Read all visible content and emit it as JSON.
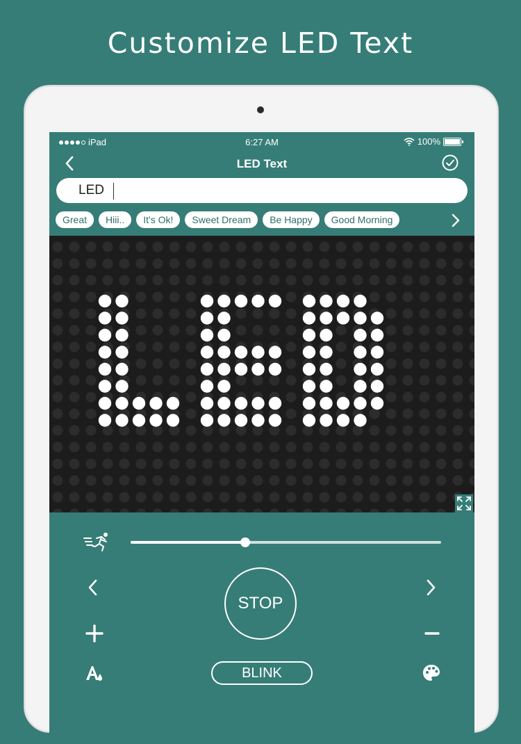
{
  "promo": {
    "title": "Customize LED Text"
  },
  "status_bar": {
    "carrier": "iPad",
    "time": "6:27 AM",
    "battery": "100%"
  },
  "nav": {
    "title": "LED Text"
  },
  "input": {
    "value": "LED"
  },
  "chips": [
    "Great",
    "Hiii..",
    "It's Ok!",
    "Sweet Dream",
    "Be Happy",
    "Good Morning"
  ],
  "display": {
    "text": "LED",
    "led_color": "#ffffff",
    "background_color": "#1c1c1c",
    "off_led_color": "#2c2c2c"
  },
  "controls": {
    "speed": 0.37,
    "stop_label": "STOP",
    "blink_label": "BLINK"
  },
  "colors": {
    "accent": "#367d77",
    "chip_text": "#2f6e69"
  },
  "icons": {
    "back": "chevron-left-icon",
    "done": "check-circle-icon",
    "more_chips": "chevron-right-icon",
    "fullscreen": "expand-icon",
    "speed": "running-man-icon",
    "prev": "chevron-left-icon",
    "next": "chevron-right-icon",
    "increase": "plus-icon",
    "decrease": "minus-icon",
    "font": "font-color-icon",
    "palette": "palette-icon"
  }
}
